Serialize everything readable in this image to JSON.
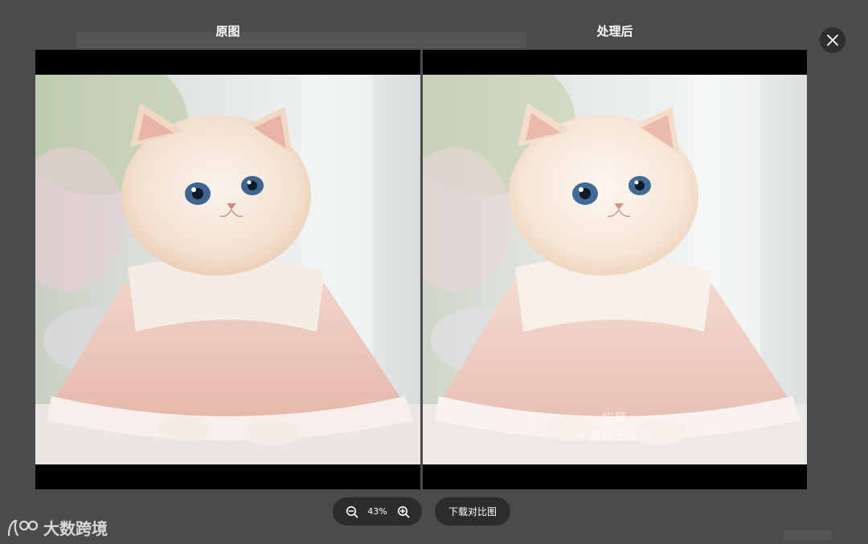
{
  "viewer": {
    "left_title": "原图",
    "right_title": "处理后",
    "watermark_line1": "佐糖",
    "watermark_line2": "下载后无水印"
  },
  "toolbar": {
    "zoom_level": "43%",
    "download_label": "下载对比图"
  },
  "brand": {
    "text": "大数跨境"
  },
  "icons": {
    "close": "close-icon",
    "zoom_out": "zoom-out-icon",
    "zoom_in": "zoom-in-icon",
    "brand_logo": "brand-logo-icon"
  },
  "colors": {
    "backdrop": "#4b4b4d",
    "button_bg": "#2c2c2e",
    "text": "#ffffff"
  }
}
